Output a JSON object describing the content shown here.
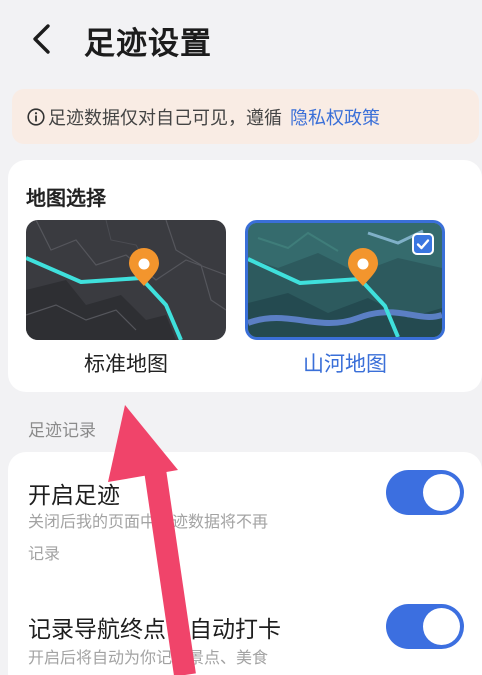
{
  "header": {
    "title": "足迹设置"
  },
  "notice": {
    "text": "足迹数据仅对自己可见，遵循",
    "link": "隐私权政策"
  },
  "map_section": {
    "title": "地图选择",
    "options": [
      {
        "label": "标准地图",
        "selected": false
      },
      {
        "label": "山河地图",
        "selected": true
      }
    ]
  },
  "record_section": {
    "label": "足迹记录",
    "rows": [
      {
        "title": "开启足迹",
        "desc_line1": "关闭后我的页面中足迹数据将不再",
        "desc_line2": "记录",
        "enabled": true
      },
      {
        "title": "记录导航终点，自动打卡",
        "desc_line1": "开启后将自动为你记录景点、美食",
        "enabled": true
      }
    ]
  },
  "colors": {
    "accent": "#3a6fd8",
    "toggle_on": "#3c6fe0",
    "notice_bg": "#f9ece4",
    "pin": "#f3952d",
    "route": "#3fe0dc"
  }
}
